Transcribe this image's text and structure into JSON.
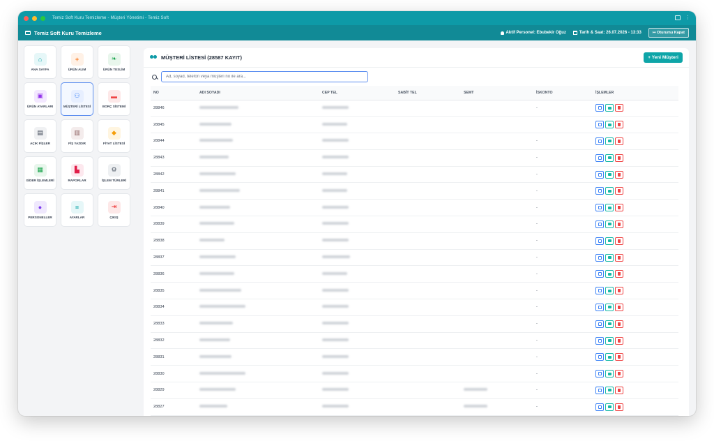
{
  "window": {
    "title": "Temiz Soft Kuru Temizleme - Müşteri Yönetimi - Temiz Soft"
  },
  "appbar": {
    "brand": "Temiz Soft Kuru Temizleme",
    "personel": "Aktif Personel: Ebubekir Oğuz",
    "datetime": "Tarih & Saat: 26.07.2026 - 13:33",
    "logout": "Oturumu Kapat"
  },
  "sidebar": {
    "items": [
      {
        "label": "ANA SAYFA",
        "icon": "home-icon",
        "color": "#0ea5a8",
        "bg": "#e6f7f8"
      },
      {
        "label": "ÜRÜN ALIM",
        "icon": "plus-circle-icon",
        "color": "#f97316",
        "bg": "#fff1e6"
      },
      {
        "label": "ÜRÜN TESLİM",
        "icon": "leaf-icon",
        "color": "#16a34a",
        "bg": "#e8f6ec"
      },
      {
        "label": "ÜRÜN AYARLARI",
        "icon": "box-icon",
        "color": "#9333ea",
        "bg": "#f3e8ff"
      },
      {
        "label": "MÜŞTERİ LİSTESİ",
        "icon": "users-icon",
        "color": "#3b82f6",
        "bg": "#e7efff"
      },
      {
        "label": "BORÇ SİSTEMİ",
        "icon": "wallet-icon",
        "color": "#ef4444",
        "bg": "#fde8e8"
      },
      {
        "label": "AÇIK FİŞLER",
        "icon": "file-icon",
        "color": "#374151",
        "bg": "#f0f1f3"
      },
      {
        "label": "FİŞ YAZDIR",
        "icon": "barcode-icon",
        "color": "#8b5e5e",
        "bg": "#f4ecec"
      },
      {
        "label": "FİYAT LİSTESİ",
        "icon": "tag-icon",
        "color": "#f59e0b",
        "bg": "#fff5e0"
      },
      {
        "label": "GİDER İŞLEMLERİ",
        "icon": "money-icon",
        "color": "#16a34a",
        "bg": "#e8f6ec"
      },
      {
        "label": "RAPORLAR",
        "icon": "chart-icon",
        "color": "#e11d48",
        "bg": "#fde8ee"
      },
      {
        "label": "İŞLEM TÜRLERİ",
        "icon": "cogs-icon",
        "color": "#4b5563",
        "bg": "#eef0f2"
      },
      {
        "label": "PERSONELLER",
        "icon": "user-icon",
        "color": "#7c3aed",
        "bg": "#efe8fd"
      },
      {
        "label": "AYARLAR",
        "icon": "sliders-icon",
        "color": "#0ea5a8",
        "bg": "#e6f7f8"
      },
      {
        "label": "ÇIKIŞ",
        "icon": "logout-icon",
        "color": "#ef4444",
        "bg": "#fde8e8"
      }
    ]
  },
  "main": {
    "title": "MÜŞTERİ LİSTESİ (28587 KAYIT)",
    "new_button": "+ Yeni Müşteri",
    "search_placeholder": "Ad, soyad, telefon veya müşteri no ile ara...",
    "columns": [
      "NO",
      "ADI SOYADI",
      "CEP TEL",
      "SABİT TEL",
      "SEMT",
      "İSKONTO",
      "İŞLEMLER"
    ],
    "rows": [
      {
        "no": "28846",
        "iskonto": "-"
      },
      {
        "no": "28845",
        "iskonto": ""
      },
      {
        "no": "28844",
        "iskonto": "-"
      },
      {
        "no": "28843",
        "iskonto": "-"
      },
      {
        "no": "28842",
        "iskonto": "-"
      },
      {
        "no": "28841",
        "iskonto": "-"
      },
      {
        "no": "28840",
        "iskonto": "-"
      },
      {
        "no": "28839",
        "iskonto": "-"
      },
      {
        "no": "28838",
        "iskonto": "-"
      },
      {
        "no": "28837",
        "iskonto": "-"
      },
      {
        "no": "28836",
        "iskonto": "-"
      },
      {
        "no": "28835",
        "iskonto": "-"
      },
      {
        "no": "28834",
        "iskonto": "-"
      },
      {
        "no": "28833",
        "iskonto": "-"
      },
      {
        "no": "28832",
        "iskonto": "-"
      },
      {
        "no": "28831",
        "iskonto": "-"
      },
      {
        "no": "28830",
        "iskonto": "-"
      },
      {
        "no": "28829",
        "iskonto": "-"
      },
      {
        "no": "28827",
        "iskonto": "-"
      }
    ]
  }
}
